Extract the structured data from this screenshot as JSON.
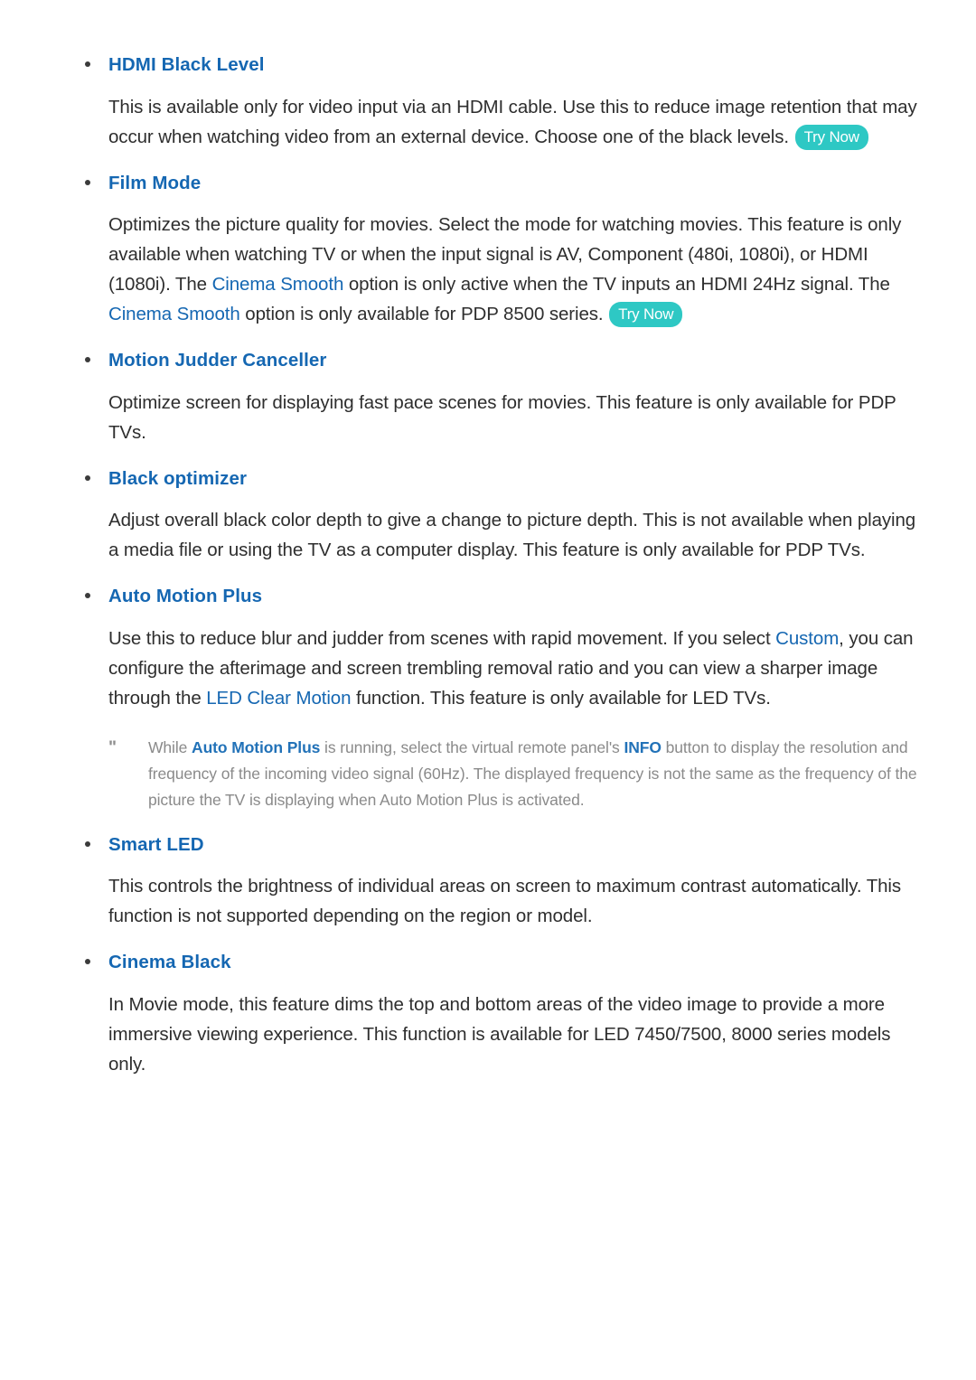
{
  "document": {
    "type": "tv-user-manual-page",
    "bullet_glyph": "•",
    "note_marker": "\"",
    "colors": {
      "heading_blue": "#1567b2",
      "inline_highlight_blue": "#1567b2",
      "body_text": "#2e2e2e",
      "note_text": "#8a8a8a",
      "note_highlight_blue": "#2272b8",
      "try_now_badge_bg": "#2ec8c4",
      "try_now_badge_text": "#ffffff",
      "page_background": "#ffffff",
      "bullet": "#3b3b3b"
    },
    "try_now_label": "Try Now"
  },
  "sections": [
    {
      "id": "hdmi-black-level",
      "heading": "HDMI Black Level",
      "paragraphs": [
        {
          "runs": [
            {
              "t": "This is available only for video input via an HDMI cable. Use this to reduce image retention that may occur when watching video from an external device. Choose one of the black levels.",
              "style": "plain"
            },
            {
              "t": "Try Now",
              "style": "badge"
            }
          ]
        }
      ]
    },
    {
      "id": "film-mode",
      "heading": "Film Mode",
      "paragraphs": [
        {
          "runs": [
            {
              "t": "Optimizes the picture quality for movies. Select the mode for watching movies. This feature is only available when watching TV or when the input signal is AV, Component (480i, 1080i), or HDMI (1080i). The ",
              "style": "plain"
            },
            {
              "t": "Cinema Smooth",
              "style": "highlight"
            },
            {
              "t": " option is only active when the TV inputs an HDMI 24Hz signal. The ",
              "style": "plain"
            },
            {
              "t": "Cinema Smooth",
              "style": "highlight"
            },
            {
              "t": " option is only available for PDP 8500 series.",
              "style": "plain"
            },
            {
              "t": "Try Now",
              "style": "badge"
            }
          ]
        }
      ]
    },
    {
      "id": "motion-judder-canceller",
      "heading": "Motion Judder Canceller",
      "paragraphs": [
        {
          "runs": [
            {
              "t": "Optimize screen for displaying fast pace scenes for movies. This feature is only available for PDP TVs.",
              "style": "plain"
            }
          ]
        }
      ]
    },
    {
      "id": "black-optimizer",
      "heading": "Black optimizer",
      "paragraphs": [
        {
          "runs": [
            {
              "t": "Adjust overall black color depth to give a change to picture depth. This is not available when playing a media file or using the TV as a computer display. This feature is only available for PDP TVs.",
              "style": "plain"
            }
          ]
        }
      ]
    },
    {
      "id": "auto-motion-plus",
      "heading": "Auto Motion Plus",
      "paragraphs": [
        {
          "runs": [
            {
              "t": "Use this to reduce blur and judder from scenes with rapid movement. If you select ",
              "style": "plain"
            },
            {
              "t": "Custom",
              "style": "highlight"
            },
            {
              "t": ", you can configure the afterimage and screen trembling removal ratio and you can view a sharper image through the ",
              "style": "plain"
            },
            {
              "t": "LED Clear Motion",
              "style": "highlight"
            },
            {
              "t": " function. This feature is only available for LED TVs.",
              "style": "plain"
            }
          ]
        }
      ],
      "note": {
        "marker": "\"",
        "runs": [
          {
            "t": "While ",
            "style": "plain"
          },
          {
            "t": "Auto Motion Plus",
            "style": "highlight"
          },
          {
            "t": " is running, select the virtual remote panel's ",
            "style": "plain"
          },
          {
            "t": "INFO",
            "style": "highlight"
          },
          {
            "t": " button to display the resolution and frequency of the incoming video signal (60Hz). The displayed frequency is not the same as the frequency of the picture the TV is displaying when Auto Motion Plus is activated.",
            "style": "plain"
          }
        ]
      }
    },
    {
      "id": "smart-led",
      "heading": "Smart LED",
      "paragraphs": [
        {
          "runs": [
            {
              "t": "This controls the brightness of individual areas on screen to maximum contrast automatically. This function is not supported depending on the region or model.",
              "style": "plain"
            }
          ]
        }
      ]
    },
    {
      "id": "cinema-black",
      "heading": "Cinema Black",
      "paragraphs": [
        {
          "runs": [
            {
              "t": "In Movie mode, this feature dims the top and bottom areas of the video image to provide a more immersive viewing experience. This function is available for LED 7450/7500, 8000 series models only.",
              "style": "plain"
            }
          ]
        }
      ]
    }
  ]
}
